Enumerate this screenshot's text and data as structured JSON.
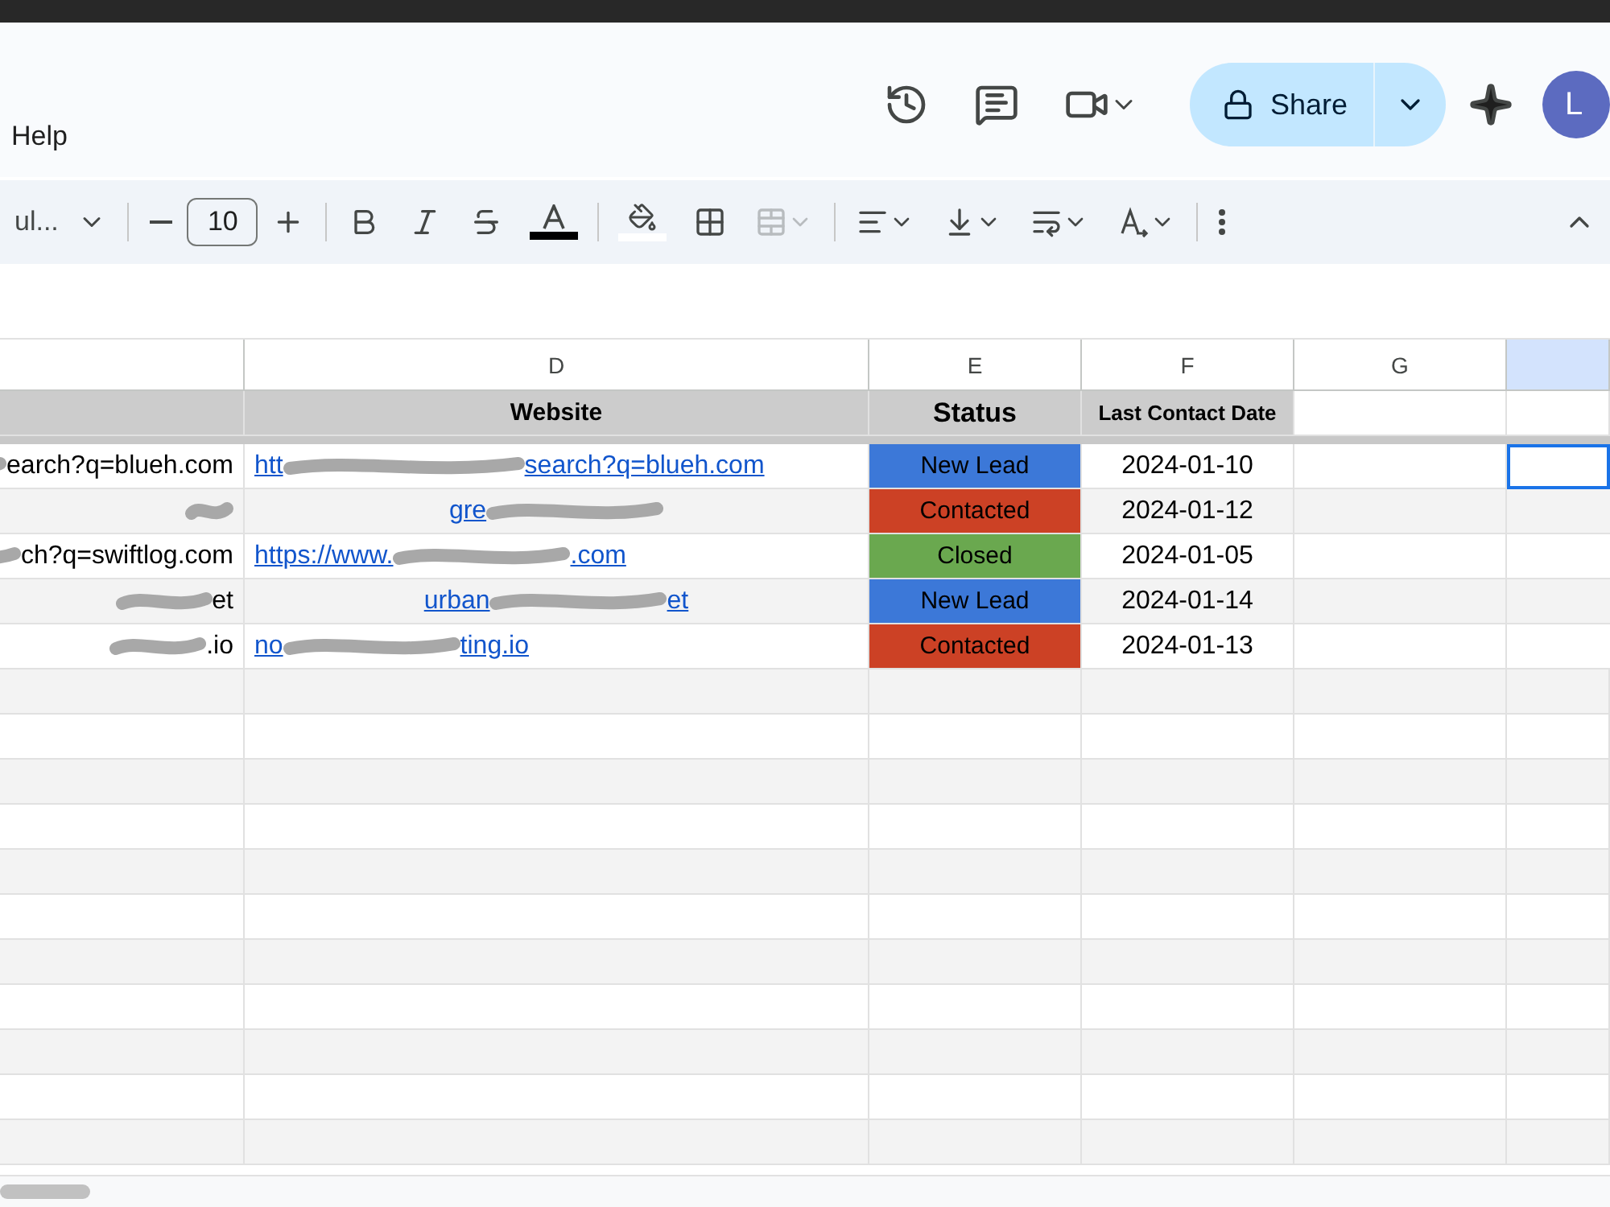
{
  "menu": {
    "items": [
      "Help"
    ]
  },
  "header_actions": {
    "share_label": "Share",
    "avatar_letter": "L"
  },
  "toolbar": {
    "font": "ul...",
    "font_size": "10",
    "merge_disabled": true
  },
  "columns": [
    {
      "selected": false
    },
    {
      "letter": "D",
      "selected": false
    },
    {
      "letter": "E",
      "selected": false
    },
    {
      "letter": "F",
      "selected": false
    },
    {
      "letter": "G",
      "selected": false
    },
    {
      "selected": true
    }
  ],
  "table_header": {
    "website": "Website",
    "status": "Status",
    "last_contact": "Last Contact Date"
  },
  "rows": [
    {
      "column_c": "earch?q=blueh.com",
      "website_start": "htt",
      "website_end": "search?q=blueh.com",
      "status": "New Lead",
      "color": "#3c78d8",
      "last_contact": "2024-01-10",
      "cell_selected": true
    },
    {
      "website_start": "gre",
      "status": "Contacted",
      "color": "#cc4125",
      "last_contact": "2024-01-12",
      "cell_selected": false
    },
    {
      "column_c": "ch?q=swiftlog.com",
      "website_start": "https://www.",
      "website_end": ".com",
      "status": "Closed",
      "color": "#6aa84f",
      "last_contact": "2024-01-05",
      "cell_selected": false
    },
    {
      "column_c": "et",
      "website_start": "urban",
      "website_end": "et",
      "status": "New Lead",
      "color": "#3c78d8",
      "last_contact": "2024-01-14",
      "cell_selected": false
    },
    {
      "column_c": ".io",
      "website_start": "no",
      "website_end": "ting.io",
      "status": "Contacted",
      "color": "#cc4125",
      "last_contact": "2024-01-13",
      "cell_selected": false
    }
  ]
}
